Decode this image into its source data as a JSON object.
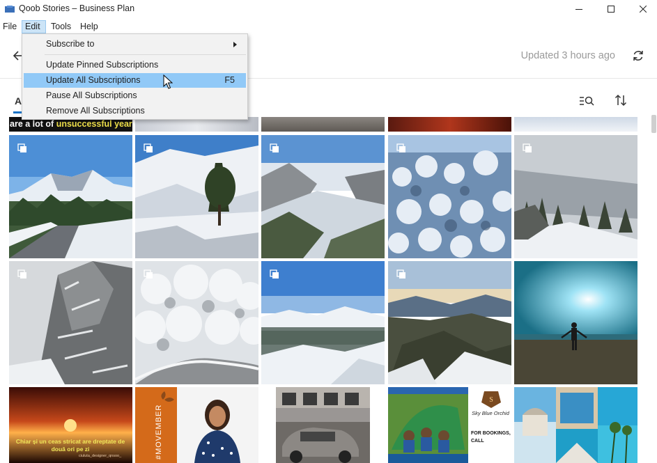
{
  "window": {
    "title": "Qoob Stories – Business Plan"
  },
  "menubar": {
    "items": [
      "File",
      "Edit",
      "Tools",
      "Help"
    ]
  },
  "dropdown": {
    "items": [
      {
        "label": "Subscribe to",
        "submenu": true
      },
      {
        "label": "Update Pinned Subscriptions"
      },
      {
        "label": "Update All Subscriptions",
        "shortcut": "F5",
        "highlighted": true
      },
      {
        "label": "Pause All Subscriptions"
      },
      {
        "label": "Remove All Subscriptions"
      }
    ]
  },
  "header": {
    "updated_text": "Updated 3 hours ago"
  },
  "tabs": {
    "first_letter": "A"
  },
  "thumbnails": {
    "row0_caption_a": "are a lot of",
    "row0_caption_b": "unsuccessful years.",
    "row3_caption_1": "Chiar și un ceas stricat are dreptate de două ori pe zi",
    "row3_caption_1_credit": "ciuluta_designer_qnsoo_",
    "row3_caption_2": "#MOVEMBER",
    "row3_caption_4a": "Sky Blue Orchid",
    "row3_caption_4b": "FOR BOOKINGS,",
    "row3_caption_4c": "CALL"
  },
  "colors": {
    "accent": "#1a73c7",
    "menu_highlight": "#91c9f7"
  }
}
